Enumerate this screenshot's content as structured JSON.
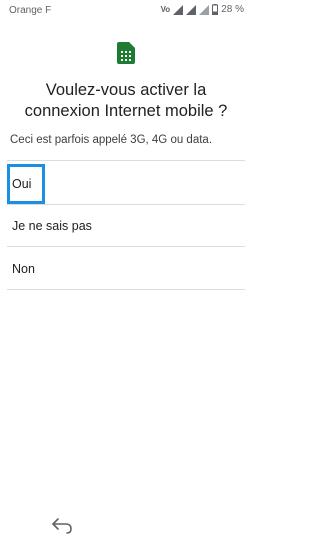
{
  "status_bar": {
    "carrier": "Orange F",
    "volte": "Vo",
    "battery_percent": "28 %"
  },
  "header": {
    "icon": "sim-card-icon",
    "accent_color": "#1e7b34",
    "title": "Voulez-vous activer la connexion Internet mobile ?",
    "subtitle": "Ceci est parfois appelé 3G, 4G ou data."
  },
  "options": [
    {
      "label": "Oui",
      "focused": true
    },
    {
      "label": "Je ne sais pas",
      "focused": false
    },
    {
      "label": "Non",
      "focused": false
    }
  ],
  "focus_color": "#1a8fe3",
  "nav": {
    "back_icon": "back-arrow-icon"
  }
}
